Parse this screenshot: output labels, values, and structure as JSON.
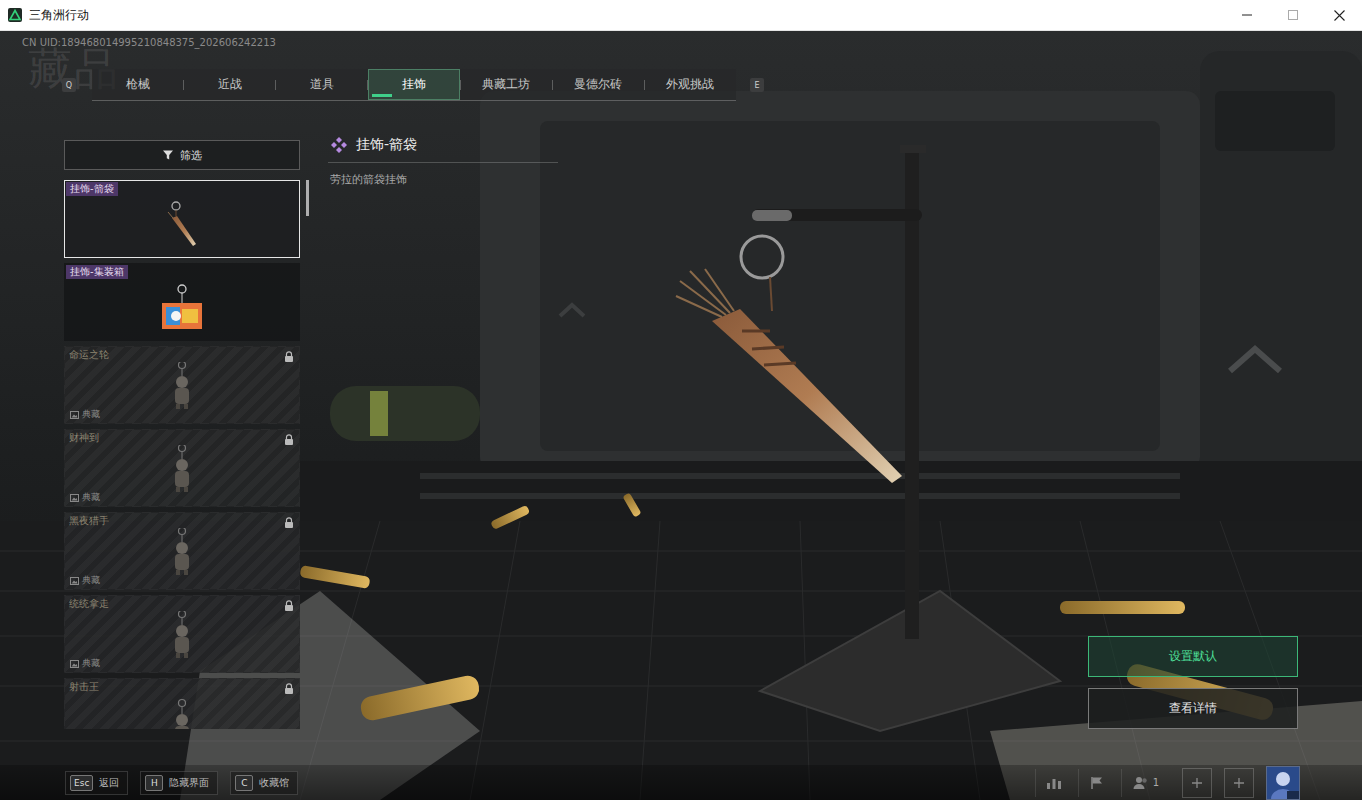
{
  "window": {
    "title": "三角洲行动"
  },
  "uid": "CN UID:189468014995210848375_202606242213",
  "page_title": "藏品",
  "tab_keys": {
    "prev": "Q",
    "next": "E"
  },
  "tabs": [
    {
      "label": "枪械",
      "selected": false
    },
    {
      "label": "近战",
      "selected": false
    },
    {
      "label": "道具",
      "selected": false
    },
    {
      "label": "挂饰",
      "selected": true
    },
    {
      "label": "典藏工坊",
      "selected": false
    },
    {
      "label": "曼德尔砖",
      "selected": false
    },
    {
      "label": "外观挑战",
      "selected": false
    }
  ],
  "filter": {
    "label": "筛选"
  },
  "items": [
    {
      "name": "挂饰-箭袋",
      "locked": false,
      "selected": true,
      "tag": ""
    },
    {
      "name": "挂饰-集装箱",
      "locked": false,
      "selected": false,
      "tag": ""
    },
    {
      "name": "命运之轮",
      "locked": true,
      "selected": false,
      "tag": "典藏"
    },
    {
      "name": "财神到",
      "locked": true,
      "selected": false,
      "tag": "典藏"
    },
    {
      "name": "黑夜猎手",
      "locked": true,
      "selected": false,
      "tag": "典藏"
    },
    {
      "name": "统统拿走",
      "locked": true,
      "selected": false,
      "tag": "典藏"
    },
    {
      "name": "射击王",
      "locked": true,
      "selected": false,
      "tag": ""
    }
  ],
  "detail": {
    "title": "挂饰-箭袋",
    "description": "劳拉的箭袋挂饰"
  },
  "actions": [
    {
      "label": "设置默认",
      "primary": true
    },
    {
      "label": "查看详情",
      "primary": false
    }
  ],
  "hints": [
    {
      "key": "Esc",
      "label": "返回"
    },
    {
      "key": "H",
      "label": "隐藏界面"
    },
    {
      "key": "C",
      "label": "收藏馆"
    }
  ],
  "social": {
    "party_count": "1"
  }
}
